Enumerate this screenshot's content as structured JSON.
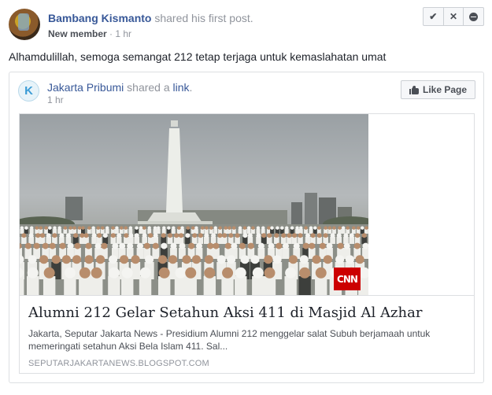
{
  "post": {
    "author": "Bambang Kismanto",
    "action": " shared his first post.",
    "role": "New member",
    "separator": " · ",
    "time": "1 hr",
    "text": "Alhamdulillah, semoga semangat 212 tetap terjaga untuk kemaslahatan umat"
  },
  "admin_actions": {
    "approve_icon": "check-icon",
    "approve_glyph": "✔",
    "decline_icon": "close-icon",
    "decline_glyph": "✕",
    "remove_icon": "remove-icon"
  },
  "shared": {
    "page_initial": "K",
    "page_name": "Jakarta Pribumi",
    "shared_text": " shared a ",
    "link_word": "link",
    "period": ".",
    "time": "1 hr",
    "like_page_label": "Like Page",
    "like_icon": "thumbs-up-icon"
  },
  "link": {
    "title": "Alumni 212 Gelar Setahun Aksi 411 di Masjid Al Azhar",
    "description": "Jakarta, Seputar Jakarta News - Presidium Alumni 212 menggelar salat Subuh berjamaah untuk memeringati setahun Aksi Bela Islam 411. Sal...",
    "domain": "SEPUTARJAKARTANEWS.BLOGSPOT.COM",
    "image_badge": "CNN"
  },
  "colors": {
    "link_blue": "#385898",
    "muted": "#90949c",
    "cnn_red": "#cc0000"
  }
}
